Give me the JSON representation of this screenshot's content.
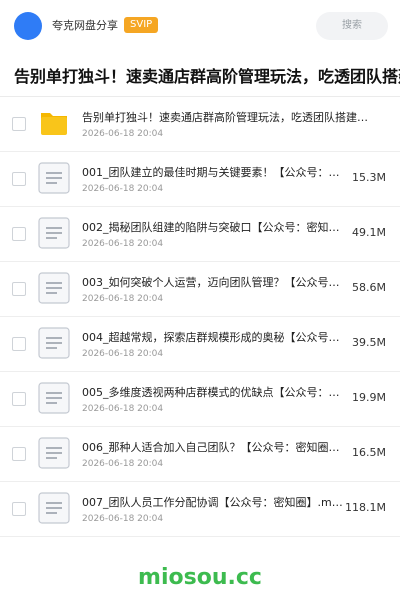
{
  "header": {
    "app_name": "夸克网盘分享",
    "badge": "SVIP",
    "search_placeholder": "搜索"
  },
  "page": {
    "title": "告别单打独斗！速卖通店群高阶管理玩法，吃透团队搭建、"
  },
  "files": [
    {
      "name": "告别单打独斗！速卖通店群高阶管理玩法，吃透团队搭建…",
      "date": "2026-06-18 20:04",
      "size": "",
      "type": "folder"
    },
    {
      "name": "001_团队建立的最佳时期与关键要素！【公众号：密…",
      "date": "2026-06-18 20:04",
      "size": "15.3M",
      "type": "doc"
    },
    {
      "name": "002_揭秘团队组建的陷阱与突破口【公众号：密知圈…",
      "date": "2026-06-18 20:04",
      "size": "49.1M",
      "type": "doc"
    },
    {
      "name": "003_如何突破个人运营，迈向团队管理？【公众号：…",
      "date": "2026-06-18 20:04",
      "size": "58.6M",
      "type": "doc"
    },
    {
      "name": "004_超越常规，探索店群规模形成的奥秘【公众号：…",
      "date": "2026-06-18 20:04",
      "size": "39.5M",
      "type": "doc"
    },
    {
      "name": "005_多维度透视两种店群模式的优缺点【公众号：密…",
      "date": "2026-06-18 20:04",
      "size": "19.9M",
      "type": "doc"
    },
    {
      "name": "006_那种人适合加入自己团队？【公众号：密知圈】…",
      "date": "2026-06-18 20:04",
      "size": "16.5M",
      "type": "doc"
    },
    {
      "name": "007_团队人员工作分配协调【公众号：密知圈】.m…",
      "date": "2026-06-18 20:04",
      "size": "118.1M",
      "type": "doc"
    }
  ],
  "watermark": "miosou.cc",
  "colors": {
    "accent": "#2f7cf6",
    "badge": "#f5a623",
    "folder": "#f9c51a",
    "watermark": "#3dbb4f"
  }
}
